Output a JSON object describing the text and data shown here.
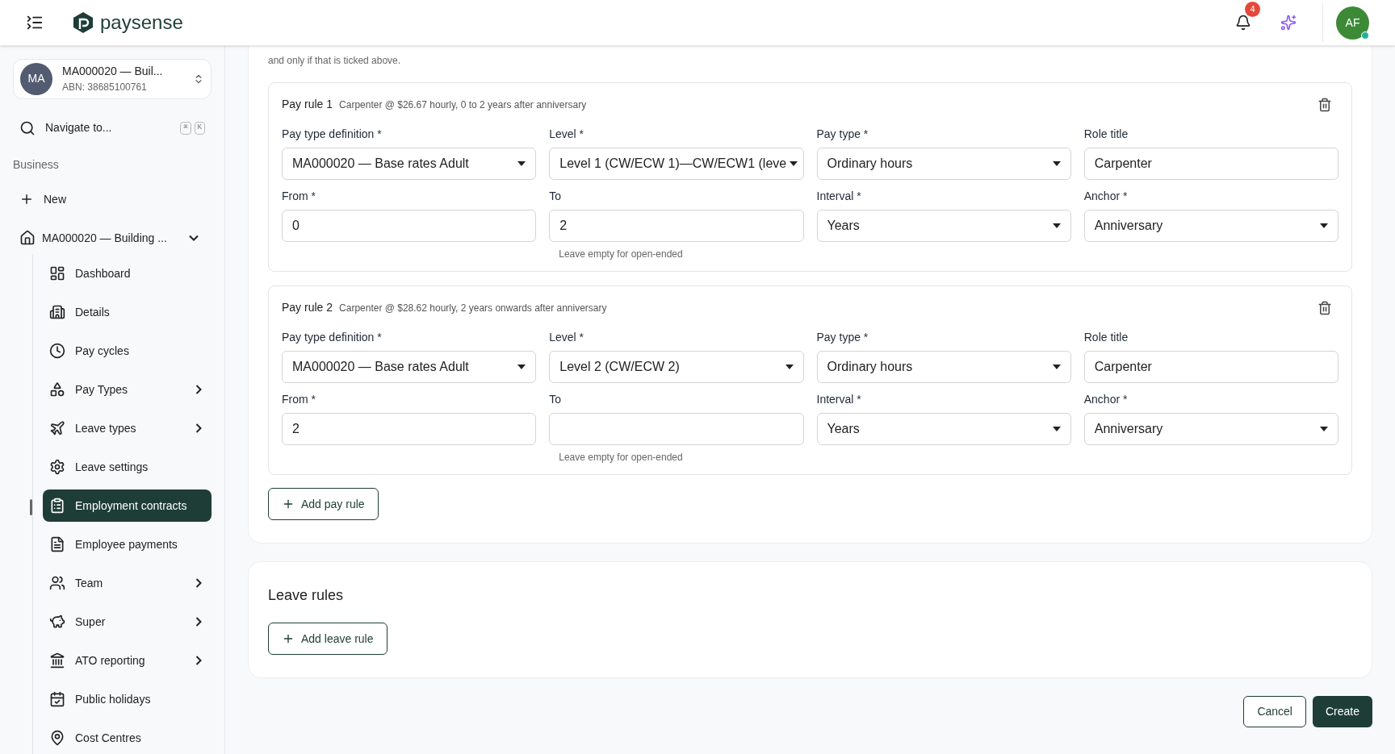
{
  "header": {
    "brand": "paysense",
    "notifications": {
      "count": "4"
    },
    "user": {
      "initials": "AF",
      "online": true
    }
  },
  "sidebar": {
    "business": {
      "initials": "MA",
      "name": "MA000020 — Buil...",
      "abn": "ABN: 38685100761"
    },
    "search": {
      "label": "Navigate to...",
      "keys": [
        "⌘",
        "K"
      ]
    },
    "section": "Business",
    "new": "New",
    "group": {
      "label": "MA000020 — Building ...",
      "expanded": true,
      "items": [
        {
          "label": "Dashboard",
          "expandable": false,
          "selected": false
        },
        {
          "label": "Details",
          "expandable": false,
          "selected": false
        },
        {
          "label": "Pay cycles",
          "expandable": false,
          "selected": false
        },
        {
          "label": "Pay Types",
          "expandable": true,
          "selected": false
        },
        {
          "label": "Leave types",
          "expandable": true,
          "selected": false
        },
        {
          "label": "Leave settings",
          "expandable": false,
          "selected": false
        },
        {
          "label": "Employment contracts",
          "expandable": false,
          "selected": true
        },
        {
          "label": "Employee payments",
          "expandable": false,
          "selected": false
        },
        {
          "label": "Team",
          "expandable": true,
          "selected": false
        },
        {
          "label": "Super",
          "expandable": true,
          "selected": false
        },
        {
          "label": "ATO reporting",
          "expandable": true,
          "selected": false
        },
        {
          "label": "Public holidays",
          "expandable": false,
          "selected": false
        },
        {
          "label": "Cost Centres",
          "expandable": false,
          "selected": false
        }
      ]
    }
  },
  "note": "and only if that is ticked above.",
  "pay_rules": [
    {
      "title": "Pay rule 1",
      "summary": "Carpenter @ $26.67 hourly, 0 to 2 years after anniversary",
      "fields": [
        {
          "label": "Pay type definition *",
          "kind": "select",
          "value": "MA000020 — Base rates Adult"
        },
        {
          "label": "Level *",
          "kind": "select",
          "value": "Level 1 (CW/ECW 1)—CW/ECW1 (leve"
        },
        {
          "label": "Pay type *",
          "kind": "select",
          "value": "Ordinary hours"
        },
        {
          "label": "Role title",
          "kind": "text",
          "value": "Carpenter"
        },
        {
          "label": "From *",
          "kind": "text",
          "value": "0"
        },
        {
          "label": "To",
          "kind": "text",
          "value": "2",
          "helper": "Leave empty for open-ended"
        },
        {
          "label": "Interval *",
          "kind": "select",
          "value": "Years"
        },
        {
          "label": "Anchor *",
          "kind": "select",
          "value": "Anniversary"
        }
      ]
    },
    {
      "title": "Pay rule 2",
      "summary": "Carpenter @ $28.62 hourly, 2 years onwards after anniversary",
      "fields": [
        {
          "label": "Pay type definition *",
          "kind": "select",
          "value": "MA000020 — Base rates Adult"
        },
        {
          "label": "Level *",
          "kind": "select",
          "value": "Level 2 (CW/ECW 2)"
        },
        {
          "label": "Pay type *",
          "kind": "select",
          "value": "Ordinary hours"
        },
        {
          "label": "Role title",
          "kind": "text",
          "value": "Carpenter"
        },
        {
          "label": "From *",
          "kind": "text",
          "value": "2"
        },
        {
          "label": "To",
          "kind": "text",
          "helper": "Leave empty for open-ended"
        },
        {
          "label": "Interval *",
          "kind": "select",
          "value": "Years"
        },
        {
          "label": "Anchor *",
          "kind": "select",
          "value": "Anniversary"
        }
      ]
    }
  ],
  "add_pay_rule": "Add pay rule",
  "leave_rules": {
    "title": "Leave rules",
    "add": "Add leave rule"
  },
  "actions": {
    "cancel": "Cancel",
    "create": "Create"
  }
}
